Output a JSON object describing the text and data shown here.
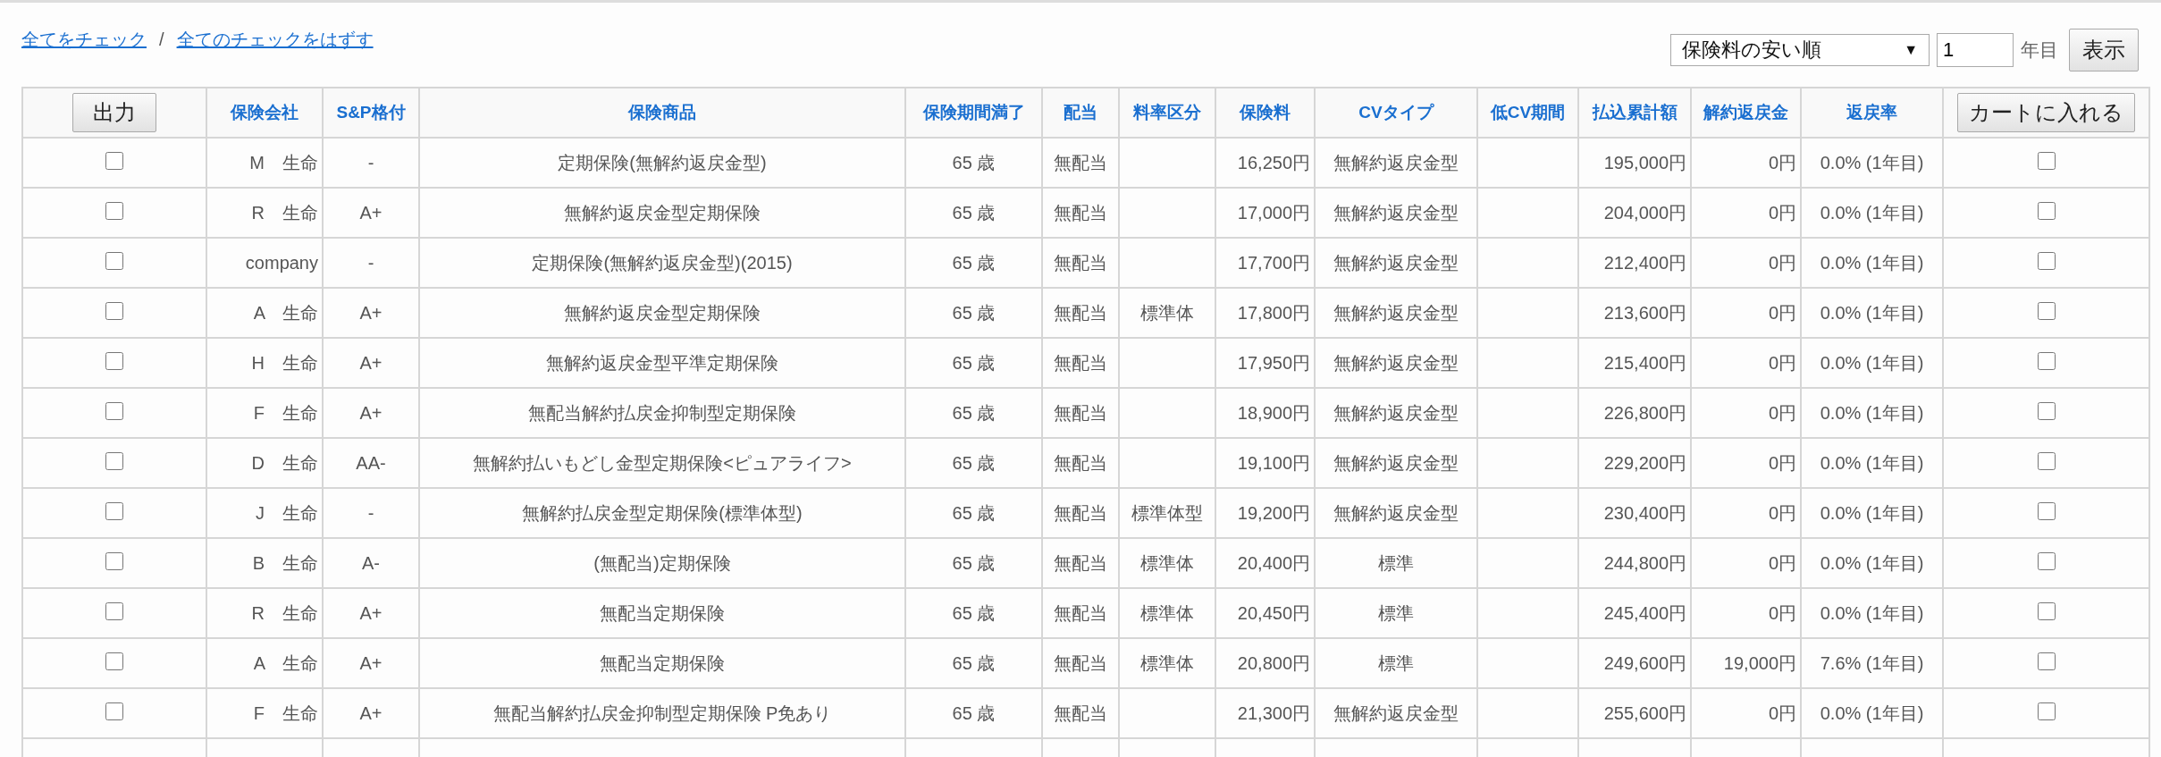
{
  "links": [
    {
      "label": "全てをチェック"
    },
    {
      "label": "全てのチェックをはずす"
    }
  ],
  "link_separator": "/",
  "sort": {
    "value": "保険料の安い順",
    "arrow": "▼"
  },
  "year_field": {
    "value": "1",
    "unit": "年目"
  },
  "show_button": "表示",
  "table": {
    "output_button": "出力",
    "cart_button": "カートに入れる",
    "columns": [
      "保険会社",
      "S&P格付",
      "保険商品",
      "保険期間満了",
      "配当",
      "料率区分",
      "保険料",
      "CVタイプ",
      "低CV期間",
      "払込累計額",
      "解約返戻金",
      "返戻率"
    ],
    "rows": [
      {
        "output_checked": false,
        "cart_checked": false,
        "cells": [
          "M　生命",
          "-",
          "定期保険(無解約返戻金型)",
          "65 歳",
          "無配当",
          "",
          "16,250円",
          "無解約返戻金型",
          "",
          "195,000円",
          "0円",
          "0.0% (1年目)"
        ]
      },
      {
        "output_checked": false,
        "cart_checked": false,
        "cells": [
          "R　生命",
          "A+",
          "無解約返戻金型定期保険",
          "65 歳",
          "無配当",
          "",
          "17,000円",
          "無解約返戻金型",
          "",
          "204,000円",
          "0円",
          "0.0% (1年目)"
        ]
      },
      {
        "output_checked": false,
        "cart_checked": false,
        "cells": [
          "company",
          "-",
          "定期保険(無解約返戻金型)(2015)",
          "65 歳",
          "無配当",
          "",
          "17,700円",
          "無解約返戻金型",
          "",
          "212,400円",
          "0円",
          "0.0% (1年目)"
        ]
      },
      {
        "output_checked": false,
        "cart_checked": false,
        "cells": [
          "A　生命",
          "A+",
          "無解約返戻金型定期保険",
          "65 歳",
          "無配当",
          "標準体",
          "17,800円",
          "無解約返戻金型",
          "",
          "213,600円",
          "0円",
          "0.0% (1年目)"
        ]
      },
      {
        "output_checked": false,
        "cart_checked": false,
        "cells": [
          "H　生命",
          "A+",
          "無解約返戻金型平準定期保険",
          "65 歳",
          "無配当",
          "",
          "17,950円",
          "無解約返戻金型",
          "",
          "215,400円",
          "0円",
          "0.0% (1年目)"
        ]
      },
      {
        "output_checked": false,
        "cart_checked": false,
        "cells": [
          "F　生命",
          "A+",
          "無配当解約払戻金抑制型定期保険",
          "65 歳",
          "無配当",
          "",
          "18,900円",
          "無解約返戻金型",
          "",
          "226,800円",
          "0円",
          "0.0% (1年目)"
        ]
      },
      {
        "output_checked": false,
        "cart_checked": false,
        "cells": [
          "D　生命",
          "AA-",
          "無解約払いもどし金型定期保険<ピュアライフ>",
          "65 歳",
          "無配当",
          "",
          "19,100円",
          "無解約返戻金型",
          "",
          "229,200円",
          "0円",
          "0.0% (1年目)"
        ]
      },
      {
        "output_checked": false,
        "cart_checked": false,
        "cells": [
          "J　生命",
          "-",
          "無解約払戻金型定期保険(標準体型)",
          "65 歳",
          "無配当",
          "標準体型",
          "19,200円",
          "無解約返戻金型",
          "",
          "230,400円",
          "0円",
          "0.0% (1年目)"
        ]
      },
      {
        "output_checked": false,
        "cart_checked": false,
        "cells": [
          "B　生命",
          "A-",
          "(無配当)定期保険",
          "65 歳",
          "無配当",
          "標準体",
          "20,400円",
          "標準",
          "",
          "244,800円",
          "0円",
          "0.0% (1年目)"
        ]
      },
      {
        "output_checked": false,
        "cart_checked": false,
        "cells": [
          "R　生命",
          "A+",
          "無配当定期保険",
          "65 歳",
          "無配当",
          "標準体",
          "20,450円",
          "標準",
          "",
          "245,400円",
          "0円",
          "0.0% (1年目)"
        ]
      },
      {
        "output_checked": false,
        "cart_checked": false,
        "cells": [
          "A　生命",
          "A+",
          "無配当定期保険",
          "65 歳",
          "無配当",
          "標準体",
          "20,800円",
          "標準",
          "",
          "249,600円",
          "19,000円",
          "7.6% (1年目)"
        ]
      },
      {
        "output_checked": false,
        "cart_checked": false,
        "cells": [
          "F　生命",
          "A+",
          "無配当解約払戻金抑制型定期保険 P免あり",
          "65 歳",
          "無配当",
          "",
          "21,300円",
          "無解約返戻金型",
          "",
          "255,600円",
          "0円",
          "0.0% (1年目)"
        ]
      }
    ]
  }
}
